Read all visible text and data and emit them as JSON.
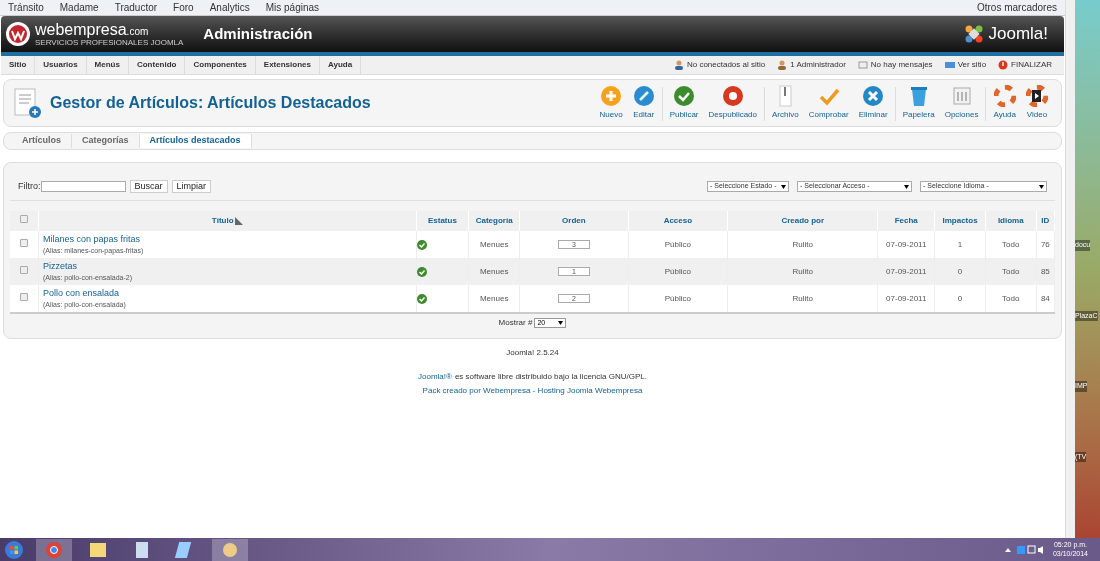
{
  "bookmarks": {
    "items": [
      "Tránsito",
      "Madame",
      "Traductor",
      "Foro",
      "Analytics",
      "Mis páginas"
    ],
    "other": "Otros marcadores"
  },
  "header": {
    "logo": "webempresa",
    "logo_suffix": ".com",
    "tagline": "SERVICIOS PROFESIONALES JOOMLA",
    "title": "Administración",
    "brand": "Joomla!"
  },
  "menu": [
    "Sitio",
    "Usuarios",
    "Menús",
    "Contenido",
    "Componentes",
    "Extensiones",
    "Ayuda"
  ],
  "status": [
    {
      "kind": "users",
      "label": "No conectados al sitio"
    },
    {
      "kind": "admin",
      "label": "1 Administrador"
    },
    {
      "kind": "mail",
      "label": "No hay mensajes"
    },
    {
      "kind": "site",
      "label": "Ver sitio"
    },
    {
      "kind": "logout",
      "label": "FINALIZAR"
    }
  ],
  "toolbar": {
    "title": "Gestor de Artículos: Artículos Destacados",
    "buttons": [
      {
        "kind": "new",
        "label": "Nuevo"
      },
      {
        "kind": "edit",
        "label": "Editar"
      },
      {
        "kind": "publish",
        "label": "Publicar"
      },
      {
        "kind": "unpublish",
        "label": "Despublicado"
      },
      {
        "kind": "archive",
        "label": "Archivo"
      },
      {
        "kind": "check",
        "label": "Comprobar"
      },
      {
        "kind": "delete",
        "label": "Eliminar"
      },
      {
        "kind": "trash",
        "label": "Papelera"
      },
      {
        "kind": "options",
        "label": "Opciones"
      },
      {
        "kind": "help",
        "label": "Ayuda"
      },
      {
        "kind": "video",
        "label": "Video"
      }
    ]
  },
  "subtabs": [
    {
      "label": "Artículos",
      "selected": false
    },
    {
      "label": "Categorías",
      "selected": false
    },
    {
      "label": "Artículos destacados",
      "selected": true
    }
  ],
  "filter": {
    "label": "Filtro:",
    "buttons": [
      "Buscar",
      "Limpiar"
    ],
    "selects": [
      "- Seleccione Estado -",
      "- Seleccionar Acceso -",
      "- Seleccione Idioma -"
    ]
  },
  "table": {
    "select_all": false,
    "columns": [
      "Título",
      "Estatus",
      "Categoría",
      "Orden",
      "Acceso",
      "Creado por",
      "Fecha",
      "Impactos",
      "Idioma",
      "ID"
    ],
    "rows": [
      {
        "checked": false,
        "title": "Milanes con papas fritas",
        "alias": "(Alias: milanes-con-papas-fritas)",
        "published": true,
        "category": "Menues",
        "order": "3",
        "access": "Público",
        "author": "Rulito",
        "date": "07-09-2011",
        "hits": "1",
        "language": "Todo",
        "id": "76"
      },
      {
        "checked": false,
        "title": "Pizzetas",
        "alias": "(Alias: pollo-con-ensalada-2)",
        "published": true,
        "category": "Menues",
        "order": "1",
        "access": "Público",
        "author": "Rulito",
        "date": "07-09-2011",
        "hits": "0",
        "language": "Todo",
        "id": "85"
      },
      {
        "checked": false,
        "title": "Pollo con ensalada",
        "alias": "(Alias: pollo-con-ensalada)",
        "published": true,
        "category": "Menues",
        "order": "2",
        "access": "Público",
        "author": "Rulito",
        "date": "07-09-2011",
        "hits": "0",
        "language": "Todo",
        "id": "84"
      }
    ]
  },
  "pagination": {
    "label": "Mostrar #",
    "value": "20"
  },
  "footer": {
    "version": "Joomla! 2.5.24",
    "license_link": "Joomla!®",
    "license_text": "es software libre distribuido bajo la licencia GNU/GPL.",
    "credit": "Pack creado por Webempresa - Hosting Joomla Webempresa"
  },
  "desktop": [
    "docu",
    "PlazaC",
    "IMP",
    "(TV"
  ],
  "taskbar": {
    "time": "05:20 p.m.",
    "date": "03/10/2014"
  }
}
